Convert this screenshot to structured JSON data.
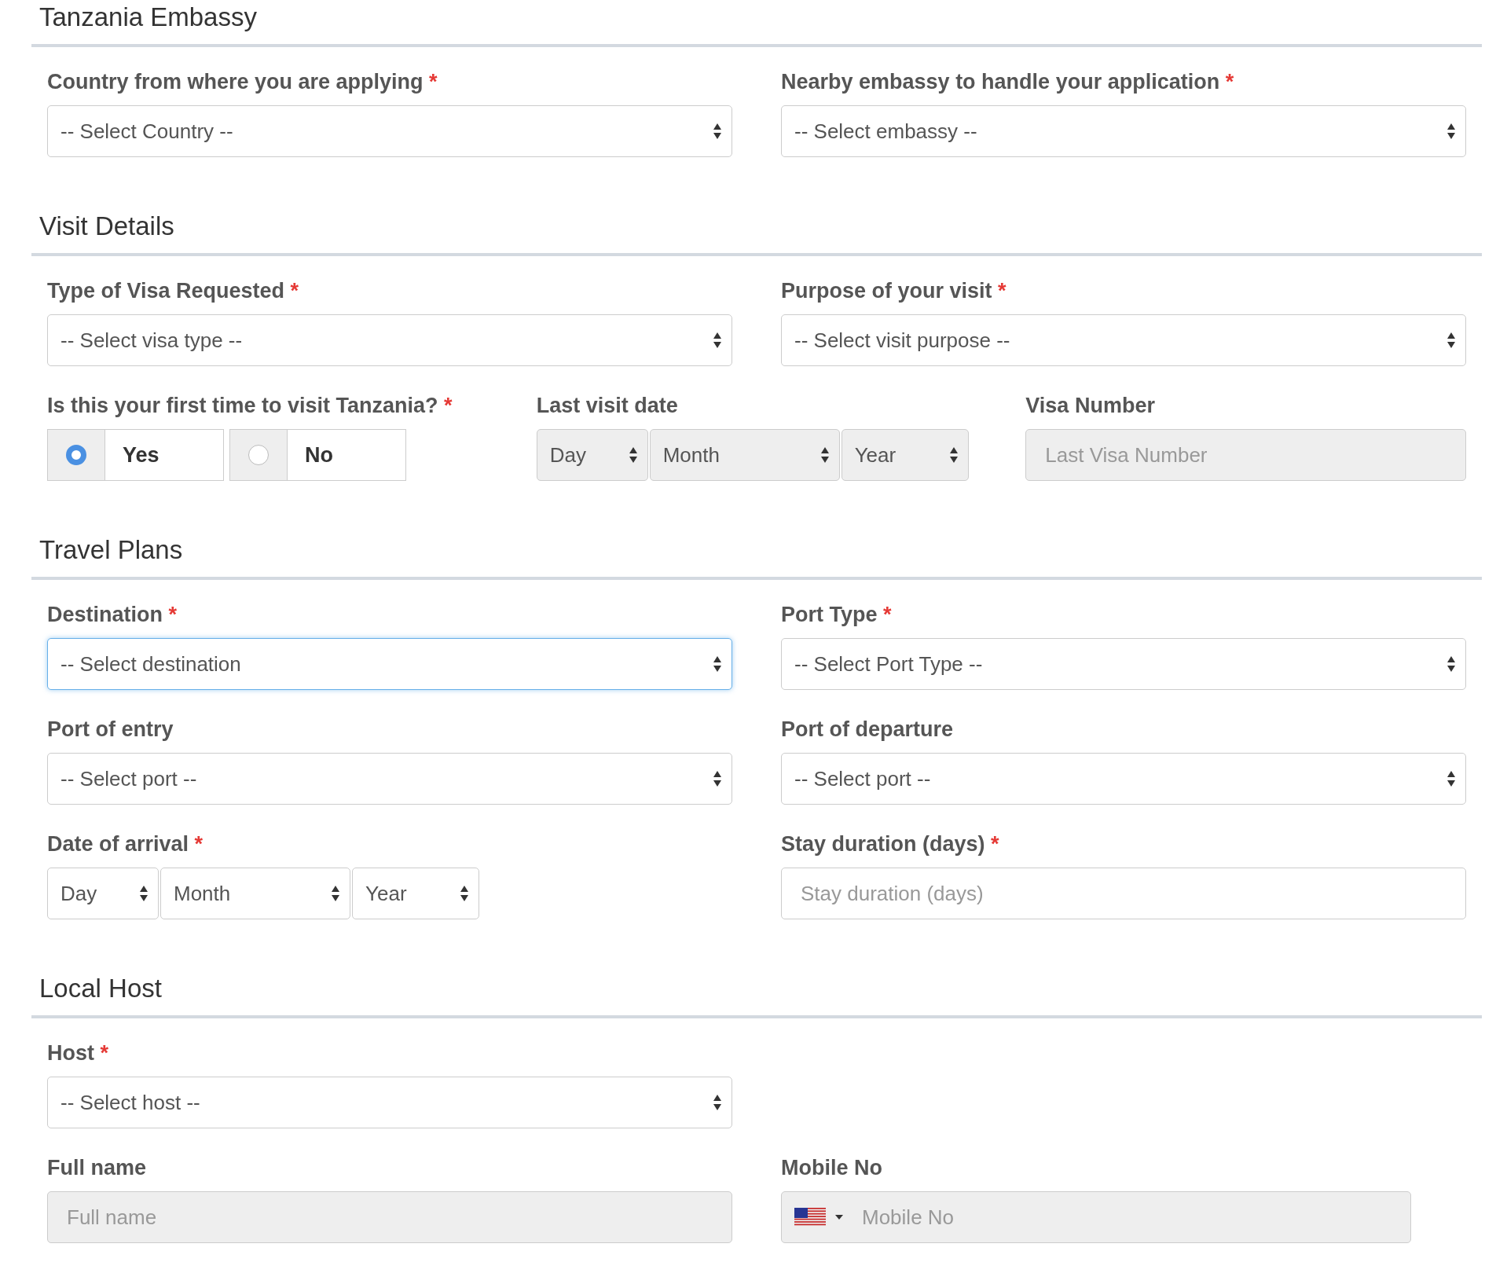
{
  "sections": [
    {
      "title": "Tanzania Embassy",
      "rows": [
        {
          "fields": [
            {
              "kind": "select",
              "label": "Country from where you are applying",
              "required_mark": "*",
              "value": "-- Select Country --"
            },
            {
              "kind": "select",
              "label": "Nearby embassy to handle your application",
              "required_mark": "*",
              "value": "-- Select embassy --"
            }
          ]
        }
      ]
    },
    {
      "title": "Visit Details",
      "rows": [
        {
          "fields": [
            {
              "kind": "select",
              "label": "Type of Visa Requested",
              "required_mark": "*",
              "value": "-- Select visa type --"
            },
            {
              "kind": "select",
              "label": "Purpose of your visit",
              "required_mark": "*",
              "value": "-- Select visit purpose --"
            }
          ]
        },
        {
          "fields": [
            {
              "kind": "radio",
              "label": "Is this your first time to visit Tanzania?",
              "required_mark": "*",
              "options": [
                {
                  "label": "Yes",
                  "selected": true
                },
                {
                  "label": "No",
                  "selected": false
                }
              ]
            },
            {
              "kind": "date",
              "label": "Last visit date",
              "disabled": true,
              "parts": [
                "Day",
                "Month",
                "Year"
              ]
            },
            {
              "kind": "text",
              "label": "Visa Number",
              "disabled": true,
              "placeholder": "Last Visa Number"
            }
          ]
        }
      ]
    },
    {
      "title": "Travel Plans",
      "rows": [
        {
          "fields": [
            {
              "kind": "select",
              "label": "Destination",
              "required_mark": "*",
              "value": "-- Select destination",
              "focused": true
            },
            {
              "kind": "select",
              "label": "Port Type",
              "required_mark": "*",
              "value": "-- Select Port Type --"
            }
          ]
        },
        {
          "fields": [
            {
              "kind": "select",
              "label": "Port of entry",
              "value": "-- Select port --"
            },
            {
              "kind": "select",
              "label": "Port of departure",
              "value": "-- Select port --"
            }
          ]
        },
        {
          "fields": [
            {
              "kind": "date",
              "label": "Date of arrival",
              "required_mark": "*",
              "disabled": false,
              "parts": [
                "Day",
                "Month",
                "Year"
              ]
            },
            {
              "kind": "text",
              "label": "Stay duration (days)",
              "required_mark": "*",
              "disabled": false,
              "placeholder": "Stay duration (days)"
            }
          ]
        }
      ]
    },
    {
      "title": "Local Host",
      "rows": [
        {
          "fields": [
            {
              "kind": "select",
              "label": "Host",
              "required_mark": "*",
              "value": "-- Select host --"
            },
            {
              "kind": "empty"
            }
          ]
        },
        {
          "fields": [
            {
              "kind": "text",
              "label": "Full name",
              "disabled": true,
              "placeholder": "Full name"
            },
            {
              "kind": "phone",
              "label": "Mobile No",
              "disabled": true,
              "placeholder": "Mobile No"
            }
          ]
        }
      ]
    }
  ]
}
